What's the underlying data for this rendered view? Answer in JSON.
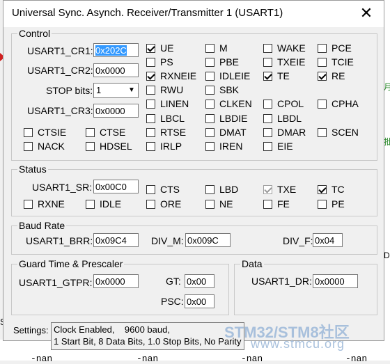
{
  "window": {
    "title": "Universal Sync. Asynch. Receiver/Transmitter 1 (USART1)",
    "close_glyph": "✕"
  },
  "background": {
    "nan_text": "-nan",
    "side_glyph_1": "月",
    "side_glyph_2": "批",
    "side_glyph_3": "D",
    "left_label": "St"
  },
  "control": {
    "label": "Control",
    "cr1_label": "USART1_CR1:",
    "cr1_value": "0x202C",
    "cr2_label": "USART1_CR2:",
    "cr2_value": "0x0000",
    "stop_label": "STOP bits:",
    "stop_value": "1",
    "cr3_label": "USART1_CR3:",
    "cr3_value": "0x0000",
    "flags": {
      "ue": {
        "label": "UE",
        "checked": true
      },
      "m": {
        "label": "M",
        "checked": false
      },
      "wake": {
        "label": "WAKE",
        "checked": false
      },
      "pce": {
        "label": "PCE",
        "checked": false
      },
      "ps": {
        "label": "PS",
        "checked": false
      },
      "pbe": {
        "label": "PBE",
        "checked": false
      },
      "txeie": {
        "label": "TXEIE",
        "checked": false
      },
      "tcie": {
        "label": "TCIE",
        "checked": false
      },
      "rxneie": {
        "label": "RXNEIE",
        "checked": true
      },
      "idleie": {
        "label": "IDLEIE",
        "checked": false
      },
      "te": {
        "label": "TE",
        "checked": true
      },
      "re": {
        "label": "RE",
        "checked": true
      },
      "rwu": {
        "label": "RWU",
        "checked": false
      },
      "sbk": {
        "label": "SBK",
        "checked": false
      },
      "linen": {
        "label": "LINEN",
        "checked": false
      },
      "clken": {
        "label": "CLKEN",
        "checked": false
      },
      "cpol": {
        "label": "CPOL",
        "checked": false
      },
      "cpha": {
        "label": "CPHA",
        "checked": false
      },
      "lbcl": {
        "label": "LBCL",
        "checked": false
      },
      "lbdie": {
        "label": "LBDIE",
        "checked": false
      },
      "lbdl": {
        "label": "LBDL",
        "checked": false
      },
      "ctsie": {
        "label": "CTSIE",
        "checked": false
      },
      "ctse": {
        "label": "CTSE",
        "checked": false
      },
      "rtse": {
        "label": "RTSE",
        "checked": false
      },
      "dmat": {
        "label": "DMAT",
        "checked": false
      },
      "dmar": {
        "label": "DMAR",
        "checked": false
      },
      "scen": {
        "label": "SCEN",
        "checked": false
      },
      "nack": {
        "label": "NACK",
        "checked": false
      },
      "hdsel": {
        "label": "HDSEL",
        "checked": false
      },
      "irlp": {
        "label": "IRLP",
        "checked": false
      },
      "iren": {
        "label": "IREN",
        "checked": false
      },
      "eie": {
        "label": "EIE",
        "checked": false
      }
    }
  },
  "status": {
    "label": "Status",
    "sr_label": "USART1_SR:",
    "sr_value": "0x00C0",
    "flags": {
      "cts": {
        "label": "CTS",
        "checked": false
      },
      "lbd": {
        "label": "LBD",
        "checked": false
      },
      "txe": {
        "label": "TXE",
        "checked": true,
        "disabled": true
      },
      "tc": {
        "label": "TC",
        "checked": true
      },
      "rxne": {
        "label": "RXNE",
        "checked": false
      },
      "idle": {
        "label": "IDLE",
        "checked": false
      },
      "ore": {
        "label": "ORE",
        "checked": false
      },
      "ne": {
        "label": "NE",
        "checked": false
      },
      "fe": {
        "label": "FE",
        "checked": false
      },
      "pe": {
        "label": "PE",
        "checked": false
      }
    }
  },
  "baud": {
    "label": "Baud Rate",
    "brr_label": "USART1_BRR:",
    "brr_value": "0x09C4",
    "divm_label": "DIV_M:",
    "divm_value": "0x009C",
    "divf_label": "DIV_F:",
    "divf_value": "0x04"
  },
  "guard": {
    "label": "Guard Time & Prescaler",
    "gtpr_label": "USART1_GTPR:",
    "gtpr_value": "0x0000",
    "gt_label": "GT:",
    "gt_value": "0x00",
    "psc_label": "PSC:",
    "psc_value": "0x00"
  },
  "data": {
    "label": "Data",
    "dr_label": "USART1_DR:",
    "dr_value": "0x0000"
  },
  "settings": {
    "label": "Settings:",
    "line1": "Clock Enabled,    9600 baud,",
    "line2": "1 Start Bit, 8 Data Bits, 1.0 Stop Bits, No Parity"
  },
  "watermark": {
    "line1": "STM32/STM8社区",
    "line2": "www.stmcu.org"
  }
}
